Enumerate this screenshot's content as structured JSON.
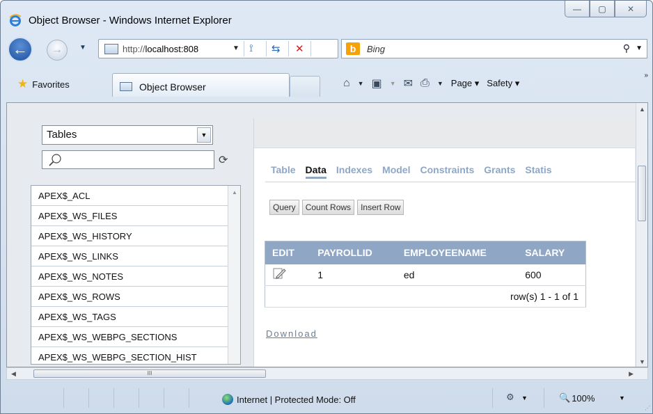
{
  "window": {
    "title": "Object Browser - Windows Internet Explorer",
    "minimize_glyph": "—",
    "maximize_glyph": "▢",
    "close_glyph": "✕"
  },
  "address_bar": {
    "url_prefix": "http://",
    "url_host": "localhost:808",
    "search_placeholder": "Bing"
  },
  "tabs_bar": {
    "favorites_label": "Favorites",
    "active_tab_label": "Object Browser",
    "page_menu": "Page ▾",
    "safety_menu": "Safety ▾"
  },
  "object_browser": {
    "type_select_value": "Tables",
    "objects": [
      "APEX$_ACL",
      "APEX$_WS_FILES",
      "APEX$_WS_HISTORY",
      "APEX$_WS_LINKS",
      "APEX$_WS_NOTES",
      "APEX$_WS_ROWS",
      "APEX$_WS_TAGS",
      "APEX$_WS_WEBPG_SECTIONS",
      "APEX$_WS_WEBPG_SECTION_HIST"
    ]
  },
  "detail": {
    "tabs": [
      "Table",
      "Data",
      "Indexes",
      "Model",
      "Constraints",
      "Grants",
      "Statis"
    ],
    "active_tab": "Data",
    "buttons": [
      "Query",
      "Count Rows",
      "Insert Row"
    ],
    "table": {
      "columns": [
        "EDIT",
        "PAYROLLID",
        "EMPLOYEENAME",
        "SALARY"
      ],
      "rows": [
        {
          "payrollid": "1",
          "employeename": "ed",
          "salary": "600"
        }
      ],
      "pagination": "row(s) 1 - 1 of 1"
    },
    "download_label": "Download"
  },
  "status_bar": {
    "zone_text": "Internet | Protected Mode: Off",
    "zoom_text": "100%"
  },
  "colors": {
    "accent": "#8fa6c4",
    "chrome": "#dfe9f5"
  },
  "icons": [
    "ie-icon",
    "back-icon",
    "forward-icon",
    "page-icon",
    "compat-icon",
    "refresh-icon",
    "stop-icon",
    "bing-icon",
    "search-icon",
    "favorites-star-icon",
    "home-icon",
    "feeds-icon",
    "mail-icon",
    "print-icon",
    "magnifier-icon",
    "object-refresh-icon",
    "edit-icon",
    "globe-icon",
    "zoom-icon"
  ]
}
